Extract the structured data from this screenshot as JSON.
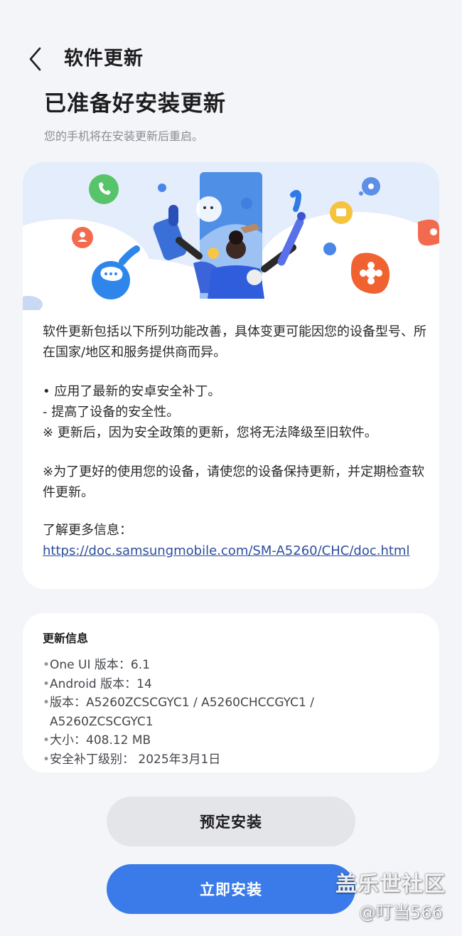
{
  "header": {
    "title": "软件更新"
  },
  "main": {
    "heading": "已准备好安装更新",
    "subtitle": "您的手机将在安装更新后重启。"
  },
  "description": {
    "intro": "软件更新包括以下所列功能改善，具体变更可能因您的设备型号、所在国家/地区和服务提供商而异。",
    "item1": "• 应用了最新的安卓安全补丁。",
    "item1_sub": " - 提高了设备的安全性。",
    "note1": "※ 更新后，因为安全政策的更新，您将无法降级至旧软件。",
    "note2": "※为了更好的使用您的设备，请使您的设备保持更新，并定期检查软件更新。",
    "more_label": "了解更多信息：",
    "link": "https://doc.samsungmobile.com/SM-A5260/CHC/doc.html"
  },
  "update_info": {
    "title": "更新信息",
    "bullet": "•",
    "lines": [
      "One UI 版本：6.1",
      "Android 版本：14",
      "版本：A5260ZCSCGYC1 / A5260CHCCGYC1 /",
      "A5260ZCSCGYC1",
      "大小：408.12 MB",
      "安全补丁级别： 2025年3月1日"
    ]
  },
  "buttons": {
    "schedule": "预定安装",
    "install": "立即安装"
  },
  "watermark": {
    "line1": "盖乐世社区",
    "line2": "@叮当566"
  },
  "colors": {
    "accent": "#3a7be9",
    "background": "#f4f5f9",
    "link": "#2d4e9d"
  }
}
